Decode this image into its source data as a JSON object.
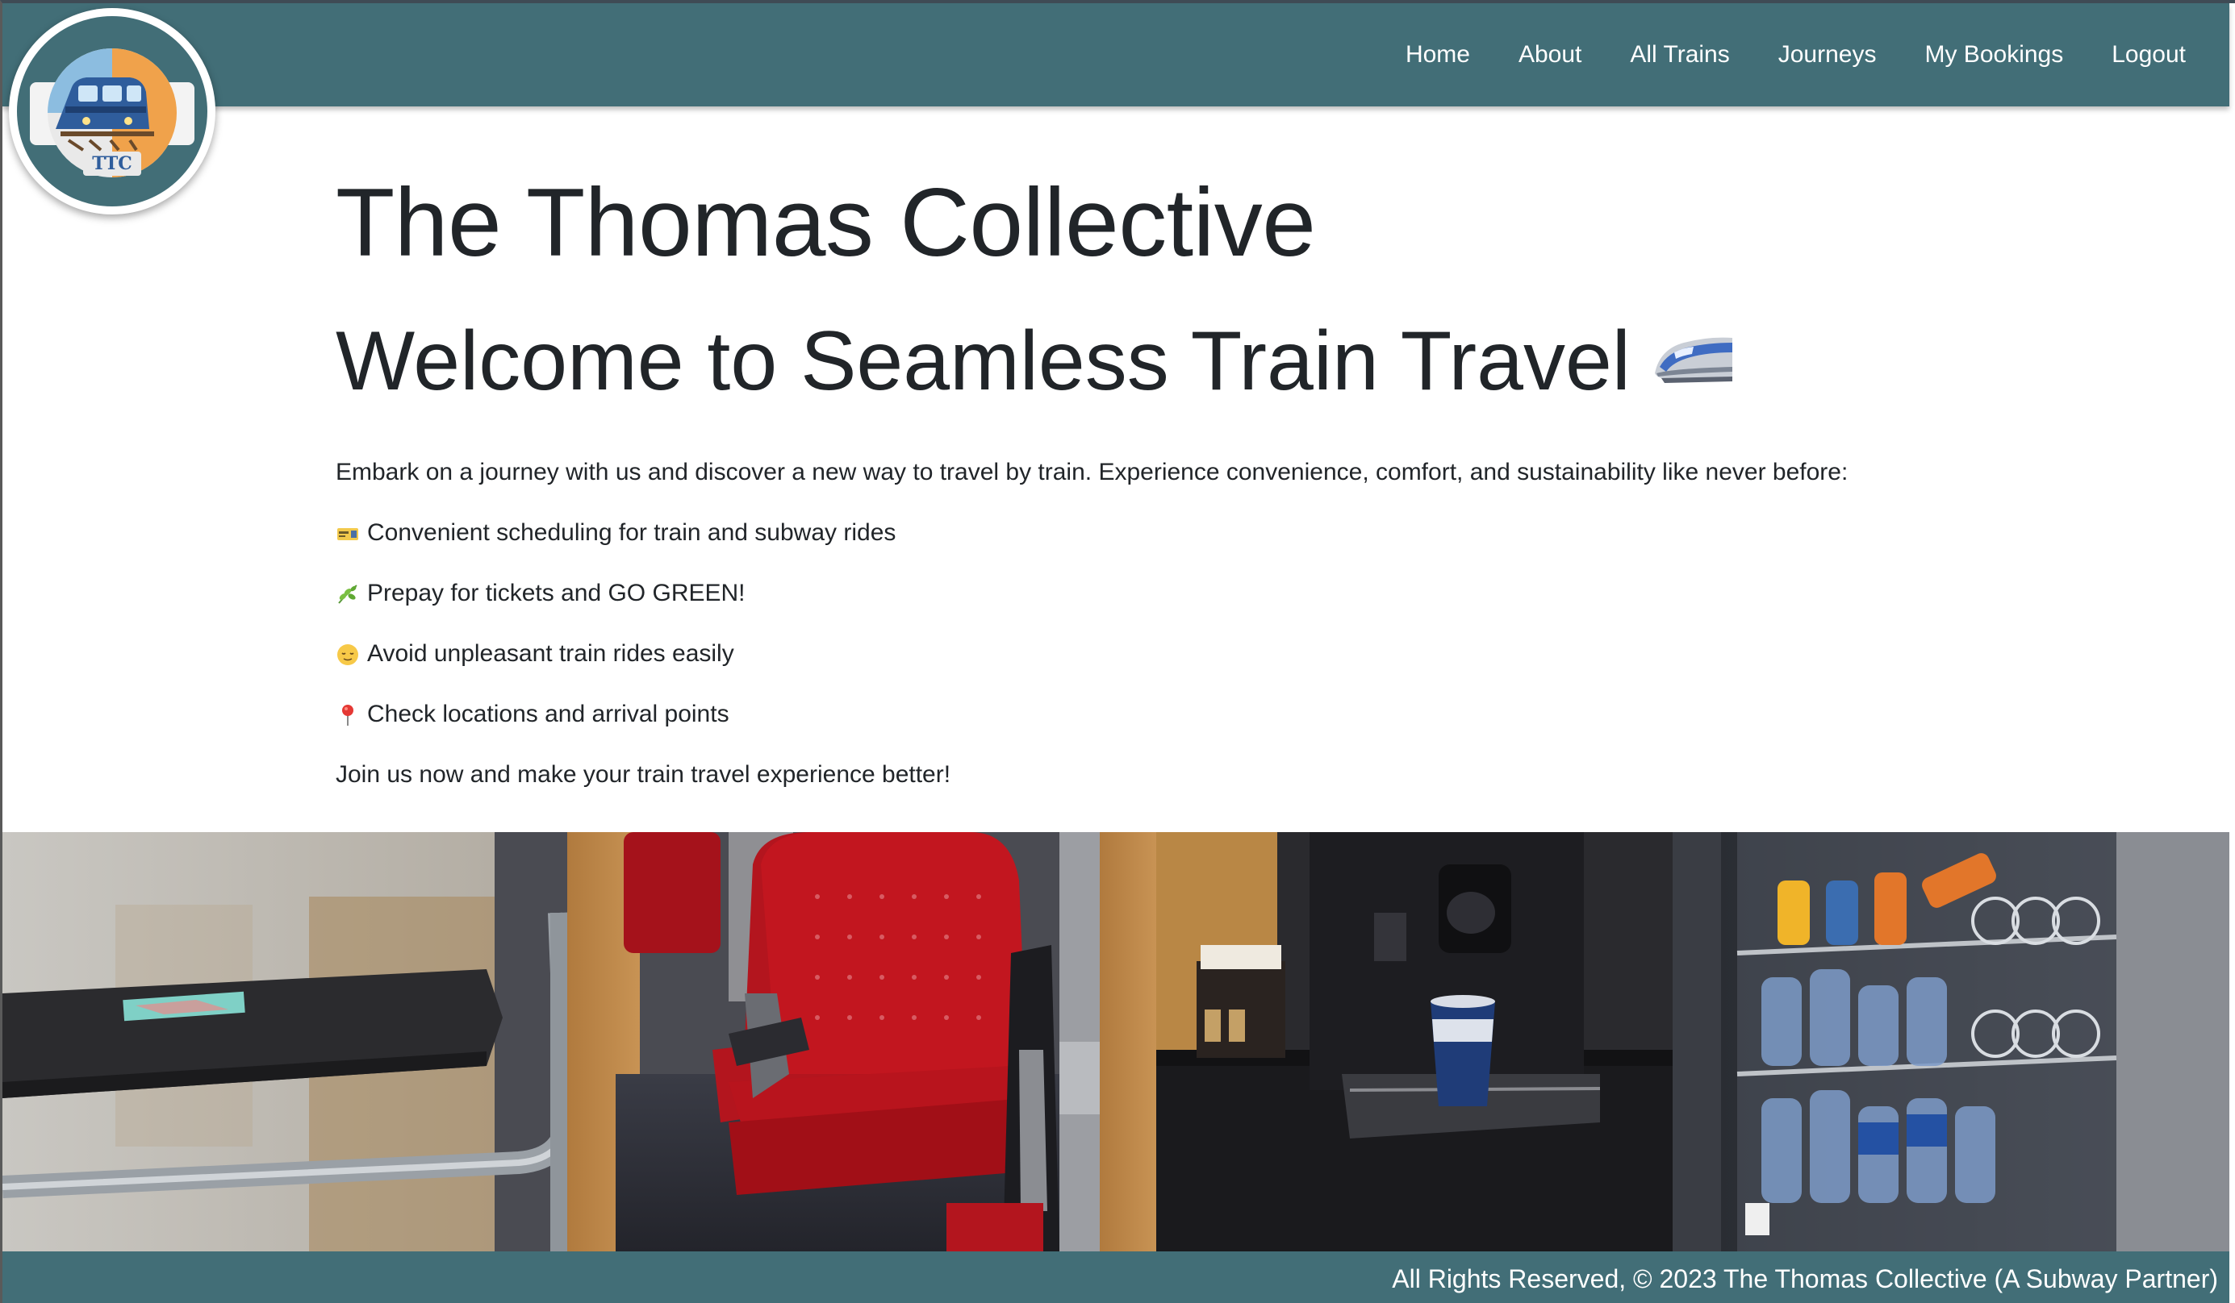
{
  "nav": {
    "links": [
      "Home",
      "About",
      "All Trains",
      "Journeys",
      "My Bookings",
      "Logout"
    ]
  },
  "logo": {
    "text": "TTC",
    "icon": "train-logo-icon"
  },
  "main": {
    "site_title": "The Thomas Collective",
    "hero_heading": "Welcome to Seamless Train Travel",
    "hero_icon": "high-speed-train-icon",
    "intro": "Embark on a journey with us and discover a new way to travel by train. Experience convenience, comfort, and sustainability like never before:",
    "features": [
      {
        "icon": "ticket-icon",
        "text": "Convenient scheduling for train and subway rides"
      },
      {
        "icon": "herb-icon",
        "text": "Prepay for tickets and GO GREEN!"
      },
      {
        "icon": "relieved-face-icon",
        "text": "Avoid unpleasant train rides easily"
      },
      {
        "icon": "round-pushpin-icon",
        "text": "Check locations and arrival points"
      }
    ],
    "closing": "Join us now and make your train travel experience better!"
  },
  "hero_image": {
    "subject": "train-interior-photo"
  },
  "footer": {
    "text": "All Rights Reserved, © 2023 The Thomas Collective (A Subway Partner)"
  },
  "colors": {
    "brand": "#426e77",
    "text": "#212529",
    "seat_red": "#b3151e"
  }
}
